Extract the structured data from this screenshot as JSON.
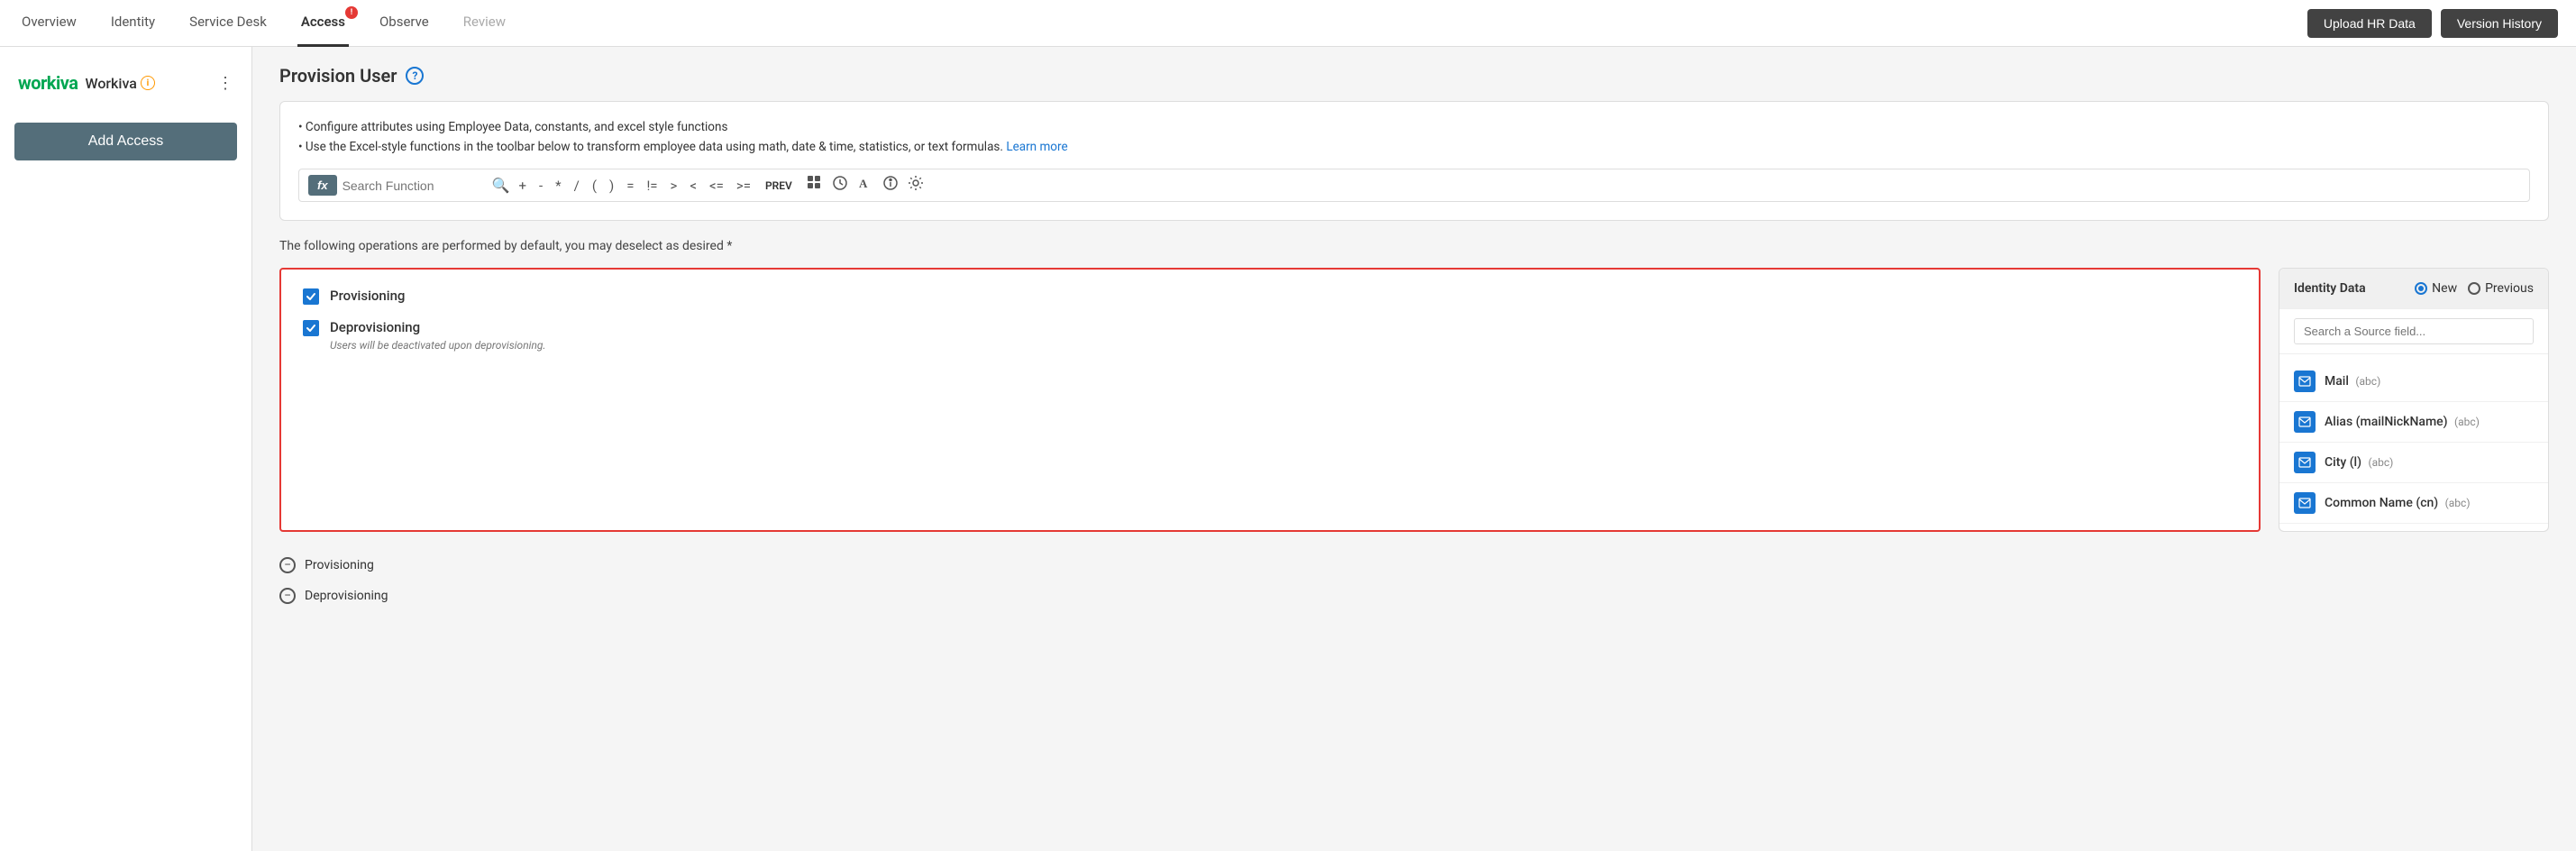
{
  "nav": {
    "items": [
      {
        "label": "Overview",
        "active": false
      },
      {
        "label": "Identity",
        "active": false
      },
      {
        "label": "Service Desk",
        "active": false
      },
      {
        "label": "Access",
        "active": true,
        "badge": "!"
      },
      {
        "label": "Observe",
        "active": false
      },
      {
        "label": "Review",
        "active": false,
        "disabled": true
      }
    ],
    "upload_hr_label": "Upload HR Data",
    "version_history_label": "Version History"
  },
  "sidebar": {
    "brand_name": "Workiva",
    "add_access_label": "Add Access"
  },
  "main": {
    "page_title": "Provision User",
    "bullets": [
      "Configure attributes using Employee Data, constants, and excel style functions",
      "Use the Excel-style functions in the toolbar below to transform employee data using math, date & time, statistics, or text formulas."
    ],
    "learn_more": "Learn more",
    "toolbar": {
      "fx_label": "fx",
      "search_placeholder": "Search Function",
      "operators": [
        "+",
        "-",
        "*",
        "/",
        "(",
        ")",
        "=",
        "!=",
        ">",
        "<",
        "<=",
        ">=",
        "PREV"
      ]
    },
    "description": "The following operations are performed by default, you may deselect as desired *",
    "operations": [
      {
        "label": "Provisioning",
        "checked": true,
        "sublabel": null
      },
      {
        "label": "Deprovisioning",
        "checked": true,
        "sublabel": "Users will be deactivated upon deprovisioning."
      }
    ],
    "bottom_operations": [
      {
        "label": "Provisioning"
      },
      {
        "label": "Deprovisioning"
      }
    ]
  },
  "identity_panel": {
    "title": "Identity Data",
    "radio_new": "New",
    "radio_previous": "Previous",
    "search_placeholder": "Search a Source field...",
    "fields": [
      {
        "name": "Mail",
        "type": "(abc)"
      },
      {
        "name": "Alias (mailNickName)",
        "type": "(abc)"
      },
      {
        "name": "City (l)",
        "type": "(abc)"
      },
      {
        "name": "Common Name (cn)",
        "type": "(abc)"
      }
    ]
  }
}
